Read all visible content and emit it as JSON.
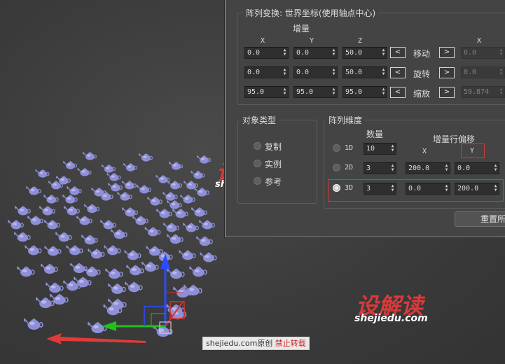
{
  "array_transform": {
    "title": "阵列变换: 世界坐标(使用轴点中心)",
    "incremental_label": "增量",
    "col_x": "X",
    "col_y": "Y",
    "col_z": "Z",
    "col_total_x": "X",
    "rows": [
      {
        "label": "移动",
        "x": "0.0",
        "y": "0.0",
        "z": "50.0",
        "total_x": "0.0"
      },
      {
        "label": "旋转",
        "x": "0.0",
        "y": "0.0",
        "z": "50.0",
        "total_x": "0.0"
      },
      {
        "label": "缩放",
        "x": "95.0",
        "y": "95.0",
        "z": "95.0",
        "total_x": "59.874"
      }
    ],
    "left_arrow": "<",
    "right_arrow": ">"
  },
  "object_type": {
    "title": "对象类型",
    "options": [
      "复制",
      "实例",
      "参考"
    ]
  },
  "array_dimensions": {
    "title": "阵列维度",
    "count_label": "数量",
    "offset_label": "增量行偏移",
    "col_x": "X",
    "col_y": "Y",
    "rows": [
      {
        "label": "1D",
        "count": "10",
        "x": "",
        "y": ""
      },
      {
        "label": "2D",
        "count": "3",
        "x": "200.0",
        "y": "0.0"
      },
      {
        "label": "3D",
        "count": "3",
        "x": "0.0",
        "y": "200.0"
      }
    ],
    "selected": "3D"
  },
  "reset_button": "重置所",
  "watermarks": {
    "logo": "设解读",
    "url": "shejiedu.com"
  },
  "footer": {
    "site": "shejiedu.com",
    "original": "原创",
    "no_repost": "禁止转载"
  },
  "colors": {
    "dialog_bg": "#444444",
    "highlight_red": "#d43a3a",
    "teapot": "#8f8fd8",
    "axis_x": "#d83030",
    "axis_y": "#20c020",
    "axis_z": "#2a4cff"
  }
}
